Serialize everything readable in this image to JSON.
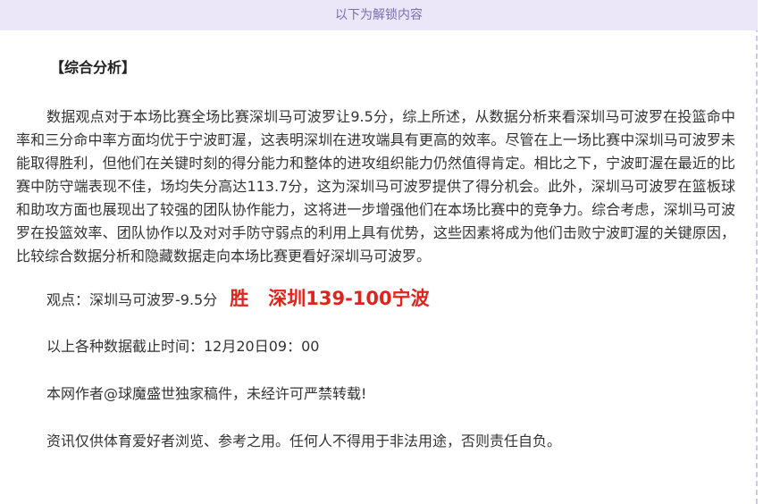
{
  "banner": {
    "text": "以下为解锁内容"
  },
  "article": {
    "heading": "【综合分析】",
    "paragraph": "数据观点对于本场比赛全场比赛深圳马可波罗让9.5分，综上所述，从数据分析来看深圳马可波罗在投篮命中率和三分命中率方面均优于宁波町渥，这表明深圳在进攻端具有更高的效率。尽管在上一场比赛中深圳马可波罗未能取得胜利，但他们在关键时刻的得分能力和整体的进攻组织能力仍然值得肯定。相比之下，宁波町渥在最近的比赛中防守端表现不佳，场均失分高达113.7分，这为深圳马可波罗提供了得分机会。此外，深圳马可波罗在篮板球和助攻方面也展现出了较强的团队协作能力，这将进一步增强他们在本场比赛中的竞争力。综合考虑，深圳马可波罗在投篮效率、团队协作以及对对手防守弱点的利用上具有优势，这些因素将成为他们击败宁波町渥的关键原因，比较综合数据分析和隐藏数据走向本场比赛更看好深圳马可波罗。",
    "verdict_label": "观点：深圳马可波罗-9.5分",
    "verdict_result": "胜",
    "verdict_score": "深圳139-100宁波",
    "cutoff": "以上各种数据截止时间：12月20日09：00",
    "copyright": "本网作者@球魔盛世独家稿件，未经许可严禁转载!",
    "disclaimer": "资讯仅供体育爱好者浏览、参考之用。任何人不得用于非法用途，否则责任自负。"
  },
  "colors": {
    "banner_bg": "#ebe7f8",
    "banner_text": "#7a6fb0",
    "highlight_red": "#e0241b"
  }
}
